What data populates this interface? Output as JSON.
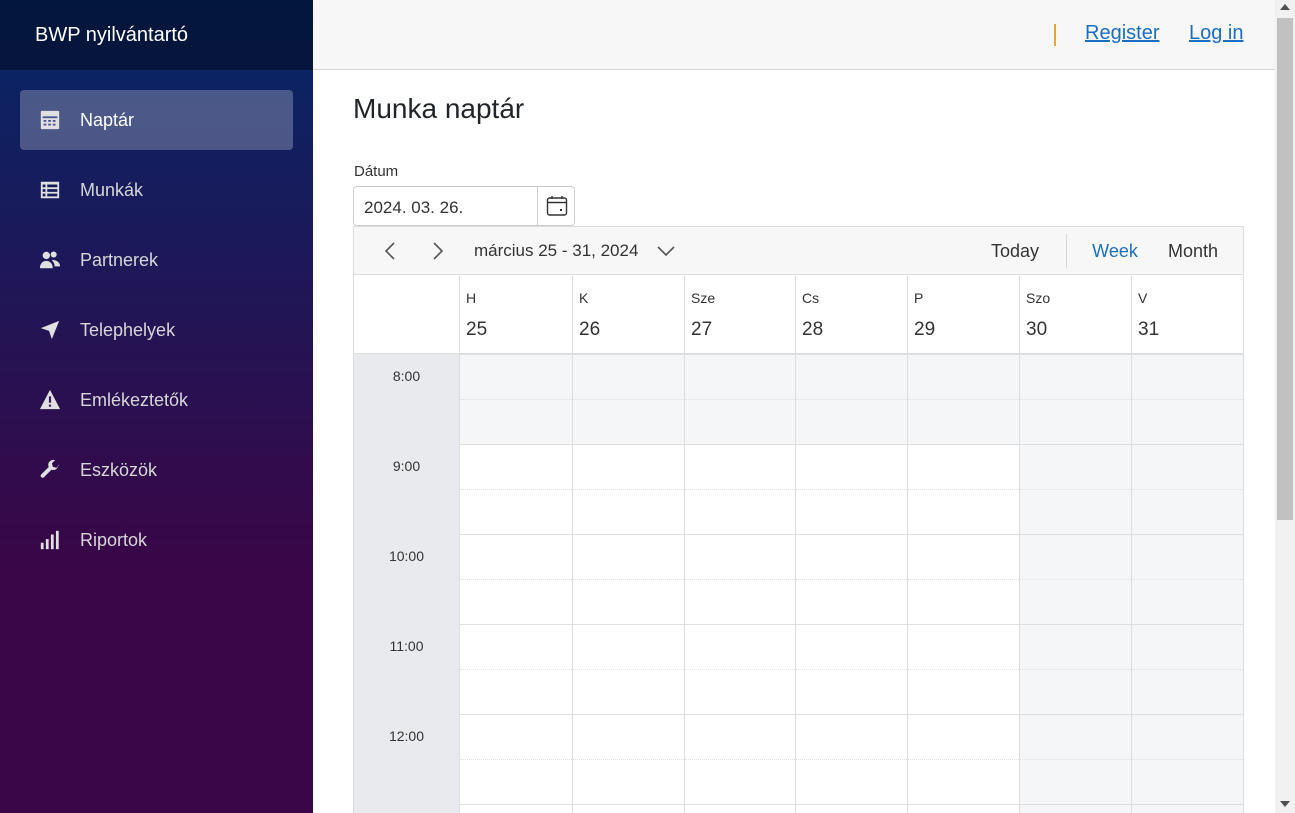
{
  "app": {
    "brand": "BWP nyilvántartó"
  },
  "sidebar": {
    "items": [
      {
        "label": "Naptár",
        "icon": "calendar-icon",
        "active": true
      },
      {
        "label": "Munkák",
        "icon": "list-icon",
        "active": false
      },
      {
        "label": "Partnerek",
        "icon": "people-icon",
        "active": false
      },
      {
        "label": "Telephelyek",
        "icon": "location-arrow-icon",
        "active": false
      },
      {
        "label": "Emlékeztetők",
        "icon": "warning-icon",
        "active": false
      },
      {
        "label": "Eszközök",
        "icon": "wrench-icon",
        "active": false
      },
      {
        "label": "Riportok",
        "icon": "bar-chart-icon",
        "active": false
      }
    ]
  },
  "topbar": {
    "register": "Register",
    "login": "Log in",
    "separator_color": "#e6a23c"
  },
  "page": {
    "title": "Munka naptár"
  },
  "date_picker": {
    "label": "Dátum",
    "value": "2024. 03. 26."
  },
  "scheduler": {
    "range": "március 25 - 31, 2024",
    "today": "Today",
    "views": {
      "week": "Week",
      "month": "Month"
    },
    "selected_view": "Week",
    "accent_color": "#1b6ec2",
    "days": [
      {
        "name": "H",
        "num": "25",
        "weekend": false
      },
      {
        "name": "K",
        "num": "26",
        "weekend": false
      },
      {
        "name": "Sze",
        "num": "27",
        "weekend": false
      },
      {
        "name": "Cs",
        "num": "28",
        "weekend": false
      },
      {
        "name": "P",
        "num": "29",
        "weekend": false
      },
      {
        "name": "Szo",
        "num": "30",
        "weekend": true
      },
      {
        "name": "V",
        "num": "31",
        "weekend": true
      }
    ],
    "times": [
      "8:00",
      "9:00",
      "10:00",
      "11:00",
      "12:00"
    ]
  }
}
